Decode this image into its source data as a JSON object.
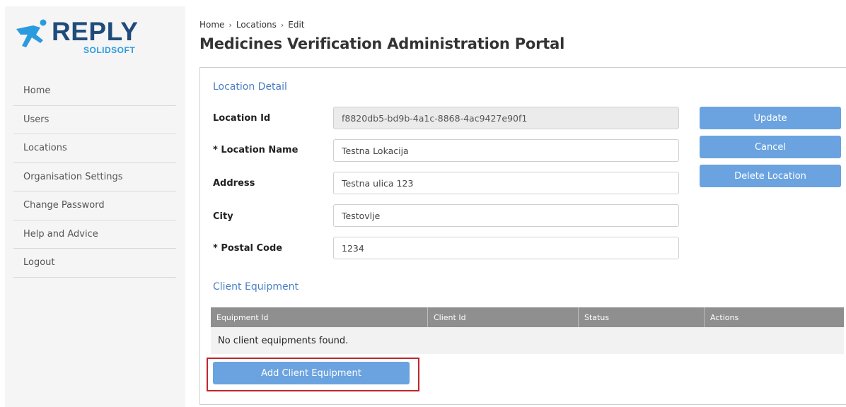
{
  "brand": {
    "name": "REPLY",
    "sub": "SOLIDSOFT",
    "colors": {
      "primary": "#1f4b7a",
      "accent": "#2b9be0"
    }
  },
  "nav": {
    "items": [
      {
        "label": "Home"
      },
      {
        "label": "Users"
      },
      {
        "label": "Locations"
      },
      {
        "label": "Organisation Settings"
      },
      {
        "label": "Change Password"
      },
      {
        "label": "Help and Advice"
      },
      {
        "label": "Logout"
      }
    ]
  },
  "breadcrumb": {
    "items": [
      "Home",
      "Locations",
      "Edit"
    ],
    "separator": "›"
  },
  "page": {
    "title": "Medicines Verification Administration Portal"
  },
  "location_detail": {
    "section_title": "Location Detail",
    "fields": {
      "location_id": {
        "label": "Location Id",
        "value": "f8820db5-bd9b-4a1c-8868-4ac9427e90f1"
      },
      "location_name": {
        "label": "* Location Name",
        "value": "Testna Lokacija"
      },
      "address": {
        "label": "Address",
        "value": "Testna ulica 123"
      },
      "city": {
        "label": "City",
        "value": "Testovlje"
      },
      "postal_code": {
        "label": "* Postal Code",
        "value": "1234"
      }
    },
    "buttons": {
      "update": "Update",
      "cancel": "Cancel",
      "delete": "Delete Location"
    }
  },
  "client_equipment": {
    "section_title": "Client Equipment",
    "columns": [
      "Equipment Id",
      "Client Id",
      "Status",
      "Actions"
    ],
    "empty_message": "No client equipments found.",
    "add_button": "Add Client Equipment"
  },
  "colors": {
    "button": "#6aa3e0",
    "section_title": "#4a7fc4",
    "table_header": "#8f8f8f",
    "highlight": "#c0262c"
  }
}
